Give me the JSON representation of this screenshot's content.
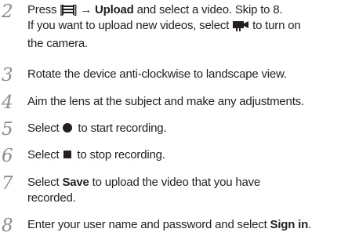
{
  "steps": [
    {
      "number": "2",
      "line1_pre": "Press [",
      "line1_post": "] → ",
      "upload_label": "Upload",
      "line1_end": " and select a video. Skip to 8.",
      "line2_pre": "If you want to upload new videos, select ",
      "line2_post": " to turn on",
      "line3": "the camera."
    },
    {
      "number": "3",
      "text": "Rotate the device anti-clockwise to landscape view."
    },
    {
      "number": "4",
      "text": "Aim the lens at the subject and make any adjustments."
    },
    {
      "number": "5",
      "pre": "Select ",
      "post": " to start recording."
    },
    {
      "number": "6",
      "pre": "Select ",
      "post": " to stop recording."
    },
    {
      "number": "7",
      "pre": "Select ",
      "save_label": "Save",
      "post": " to upload the video that you have",
      "line2": "recorded."
    },
    {
      "number": "8",
      "pre": "Enter your user name and password and select ",
      "signin_label": "Sign in",
      "post": "."
    }
  ],
  "icons": {
    "menu_key": "menu-key-icon",
    "camera": "video-camera-icon",
    "record": "record-icon",
    "stop": "stop-icon"
  },
  "colors": {
    "text": "#231f20",
    "step_number": "#8c8c8c"
  }
}
